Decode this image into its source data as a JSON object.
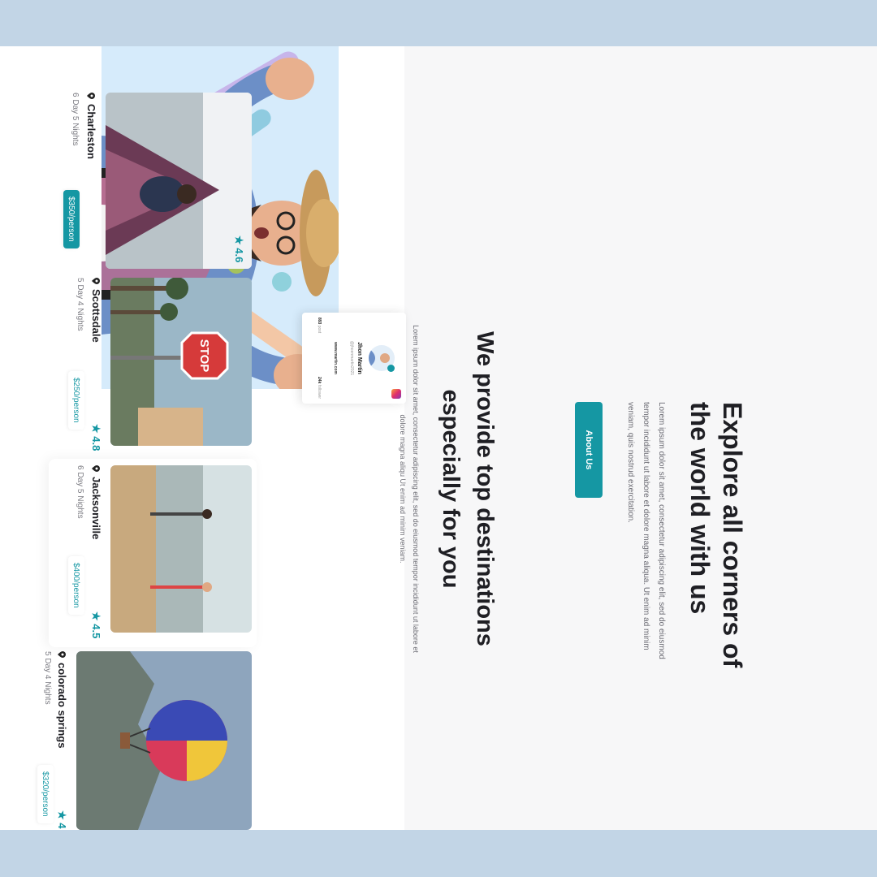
{
  "hero": {
    "title": "Explore all corners of the world with us",
    "text": "Lorem ipsum dolor sit amet, consectetur adipiscing elit, sed do eiusmod tempor incididunt ut labore et dolore magna aliqua. Ut enim ad minim veniam, quis nostrud exercitation.",
    "button_label": "About Us"
  },
  "profile": {
    "name": "Jhon Martin",
    "handle": "@jhoenmartin2021",
    "website": "www.martin.com",
    "posts_value": "893",
    "posts_label": "post",
    "followers_value": "24k",
    "followers_label": "follower"
  },
  "destinations": {
    "title": "We provide top destinations especially for you",
    "text": "Lorem ipsum dolor sit amet, consectetur adipiscing elit, sed do eiusmod tempor incididunt ut labore et dolore magna aliqu Ut enim ad minim veniam.",
    "cards": [
      {
        "name": "Charleston",
        "duration": "6 Day 5 Nights",
        "rating": "4.6",
        "price": "$350/person"
      },
      {
        "name": "Scottsdale",
        "duration": "5 Day 4 Nights",
        "rating": "4.8",
        "price": "$250/person"
      },
      {
        "name": "Jacksonville",
        "duration": "6 Day 5 Nights",
        "rating": "4.5",
        "price": "$400/person"
      },
      {
        "name": "colorado springs",
        "duration": "5 Day 4 Nights",
        "rating": "4",
        "price": "$320/person"
      }
    ]
  },
  "colors": {
    "accent": "#1597a3",
    "background": "#c2d5e6",
    "hero_bg": "#d6ebfb"
  }
}
